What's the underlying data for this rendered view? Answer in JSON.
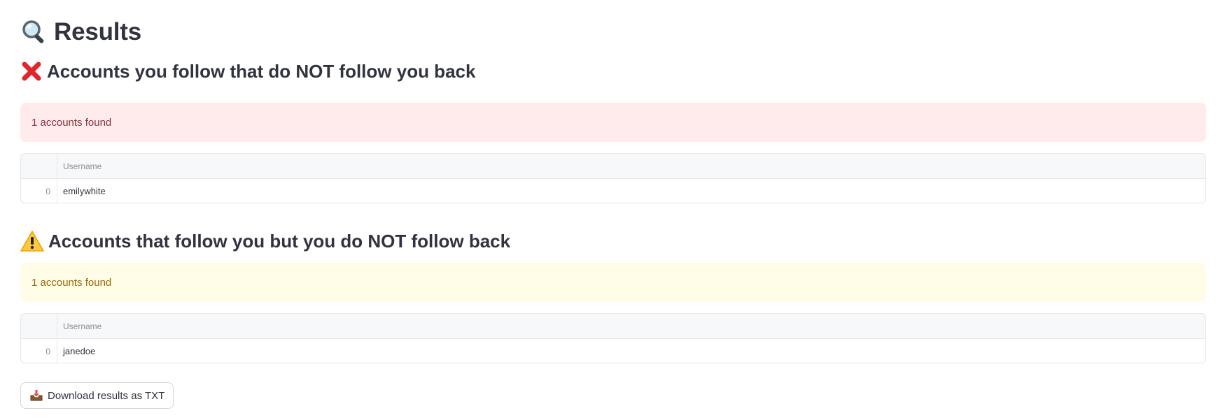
{
  "page": {
    "title": "Results",
    "title_icon": "magnifying-glass-icon"
  },
  "sections": [
    {
      "heading": "Accounts you follow that do NOT follow you back",
      "heading_icon": "red-cross-icon",
      "alert_text": "1 accounts found",
      "alert_kind": "error",
      "table": {
        "columns": [
          "Username"
        ],
        "rows": [
          {
            "index": "0",
            "username": "emilywhite"
          }
        ]
      }
    },
    {
      "heading": "Accounts that follow you but you do NOT follow back",
      "heading_icon": "warning-icon",
      "alert_text": "1 accounts found",
      "alert_kind": "warning",
      "table": {
        "columns": [
          "Username"
        ],
        "rows": [
          {
            "index": "0",
            "username": "janedoe"
          }
        ]
      }
    }
  ],
  "download": {
    "label": "Download results as TXT",
    "icon": "inbox-tray-icon"
  },
  "colors": {
    "error_bg": "#ffebeb",
    "error_text": "#7d353b",
    "warning_bg": "#fffce7",
    "warning_text": "#926c05"
  }
}
